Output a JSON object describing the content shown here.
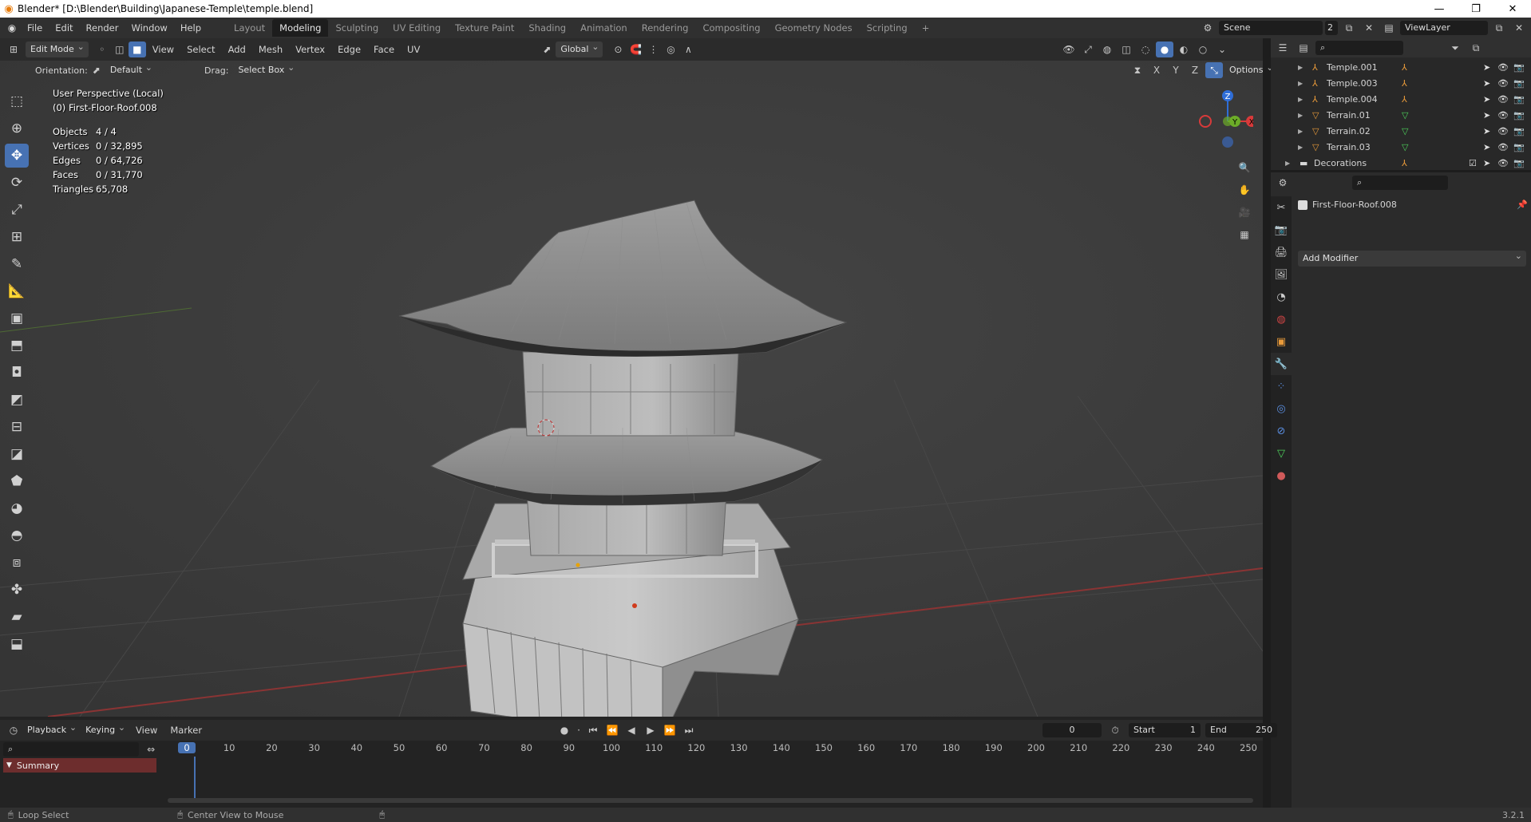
{
  "window": {
    "title": "Blender* [D:\\Blender\\Building\\Japanese-Temple\\temple.blend]",
    "minimize": "—",
    "maximize": "❐",
    "close": "✕"
  },
  "top_menu": [
    "File",
    "Edit",
    "Render",
    "Window",
    "Help"
  ],
  "workspace_tabs": [
    "Layout",
    "Modeling",
    "Sculpting",
    "UV Editing",
    "Texture Paint",
    "Shading",
    "Animation",
    "Rendering",
    "Compositing",
    "Geometry Nodes",
    "Scripting"
  ],
  "active_workspace": "Modeling",
  "add_workspace": "+",
  "scene": {
    "name": "Scene",
    "count": "2",
    "view_layer": "ViewLayer"
  },
  "viewport_header": {
    "mode": "Edit Mode",
    "menus": [
      "View",
      "Select",
      "Add",
      "Mesh",
      "Vertex",
      "Edge",
      "Face",
      "UV"
    ],
    "transform": "Global",
    "orientation_label": "Orientation:",
    "orientation": "Default",
    "drag_label": "Drag:",
    "drag": "Select Box",
    "options": "Options",
    "axes": [
      "X",
      "Y",
      "Z"
    ]
  },
  "overlay": {
    "view": "User Perspective (Local)",
    "object": "(0) First-Floor-Roof.008",
    "stats": [
      {
        "label": "Objects",
        "value": "4 / 4"
      },
      {
        "label": "Vertices",
        "value": "0 / 32,895"
      },
      {
        "label": "Edges",
        "value": "0 / 64,726"
      },
      {
        "label": "Faces",
        "value": "0 / 31,770"
      },
      {
        "label": "Triangles",
        "value": "65,708"
      }
    ]
  },
  "gizmo": {
    "z": "Z",
    "y": "Y",
    "x": "X"
  },
  "outliner": {
    "items": [
      {
        "name": "Temple.001",
        "type": "armature"
      },
      {
        "name": "Temple.003",
        "type": "armature"
      },
      {
        "name": "Temple.004",
        "type": "armature"
      },
      {
        "name": "Terrain.01",
        "type": "mesh"
      },
      {
        "name": "Terrain.02",
        "type": "mesh"
      },
      {
        "name": "Terrain.03",
        "type": "mesh"
      },
      {
        "name": "Decorations",
        "type": "collection"
      }
    ]
  },
  "properties": {
    "object_name": "First-Floor-Roof.008",
    "add_modifier": "Add Modifier"
  },
  "timeline": {
    "menus": [
      "Playback",
      "Keying",
      "View",
      "Marker"
    ],
    "current_frame": "0",
    "start_label": "Start",
    "start": "1",
    "end_label": "End",
    "end": "250",
    "ticks": [
      "0",
      "10",
      "20",
      "30",
      "40",
      "50",
      "60",
      "70",
      "80",
      "90",
      "100",
      "110",
      "120",
      "130",
      "140",
      "150",
      "160",
      "170",
      "180",
      "190",
      "200",
      "210",
      "220",
      "230",
      "240",
      "250"
    ],
    "summary": "Summary"
  },
  "status": {
    "left": "Loop Select",
    "middle": "Center View to Mouse",
    "version": "3.2.1"
  }
}
